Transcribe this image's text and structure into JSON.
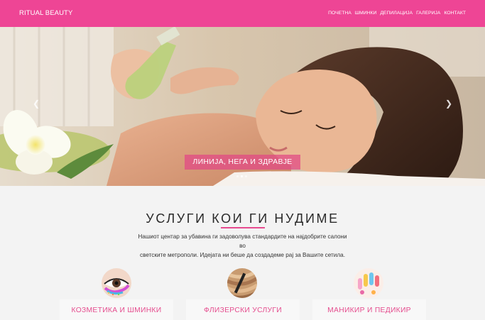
{
  "navbar": {
    "brand": "RITUAL BEAUTY",
    "items": [
      "ПОЧЕТНА",
      "ШМИНКИ",
      "ДЕПИЛАЦИЈА",
      "ГАЛЕРИЈА",
      "КОНТАКТ"
    ],
    "background_color": "#ee4595"
  },
  "hero": {
    "caption": "ЛИНИЈА, НЕГА И ЗДРАВЈЕ",
    "prev_icon": "chevron-left-icon",
    "next_icon": "chevron-right-icon",
    "slide_count": 3,
    "active_slide": 2
  },
  "services": {
    "title": "УСЛУГИ КОИ ГИ НУДИМЕ",
    "description_line1": "Нашиот центар за убавина ги задоволува стандардите на најдобрите салони во",
    "description_line2": "светските метрополи. Идејата ни беше да создадеме рај за Вашите сетила.",
    "accent_color": "#e54d8e",
    "cards": [
      {
        "label": "КОЗМЕТИКА И ШМИНКИ",
        "image": "makeup-eye-image"
      },
      {
        "label": "ФЛИЗЕРСКИ УСЛУГИ",
        "image": "hair-image"
      },
      {
        "label": "МАНИКИР И ПЕДИКИР",
        "image": "nails-image"
      }
    ]
  }
}
